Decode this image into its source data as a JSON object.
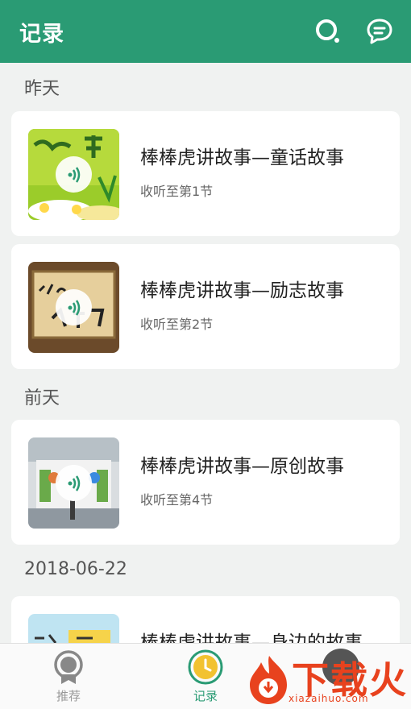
{
  "header": {
    "title": "记录",
    "icons": [
      "search-icon",
      "message-icon"
    ],
    "color": "#2a9b74"
  },
  "sections": [
    {
      "label": "昨天",
      "items": [
        {
          "name": "棒棒虎讲故事—童话故事",
          "progress": "收听至第1节"
        },
        {
          "name": "棒棒虎讲故事—励志故事",
          "progress": "收听至第2节"
        }
      ]
    },
    {
      "label": "前天",
      "items": [
        {
          "name": "棒棒虎讲故事—原创故事",
          "progress": "收听至第4节"
        }
      ]
    },
    {
      "label": "2018-06-22",
      "items": [
        {
          "name": "棒棒虎讲故事—身边的故事",
          "progress": ""
        }
      ]
    }
  ],
  "tabbar": {
    "tabs": [
      {
        "label": "推荐",
        "icon": "medal-icon",
        "active": false
      },
      {
        "label": "记录",
        "icon": "clock-icon",
        "active": true
      }
    ]
  },
  "watermark": {
    "text": "下载火",
    "url": "xiazaihuo.com"
  }
}
